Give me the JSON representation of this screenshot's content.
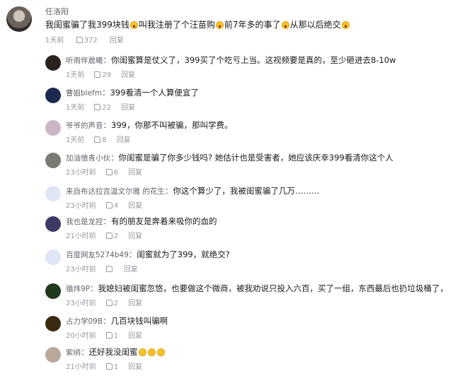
{
  "main": {
    "username": "任洛阳",
    "content_segments": [
      "我闺蜜骗了我399块钱",
      "叫我注册了个汪苗购",
      "前7年多的事了",
      "从那以后绝交"
    ],
    "time": "1天前",
    "likes": "372",
    "reply_label": "回复"
  },
  "replies": [
    {
      "user": "听雨伴晨曦",
      "text": "你闺蜜算是仗义了，399买了个吃亏上当。这视频要是真的，至少砸进去8-10w",
      "time": "1天前",
      "likes": "29",
      "reply": "回复",
      "avatar_color": "#2b2220"
    },
    {
      "user": "曹姐blefm",
      "text": "399看清一个人算便宜了",
      "time": "1天前",
      "likes": "22",
      "reply": "回复",
      "avatar_color": "#1d2a4e"
    },
    {
      "user": "爷爷的声音",
      "text": "399，你那不叫被骗，那叫学费。",
      "time": "1天前",
      "likes": "8",
      "reply": "回复",
      "avatar_color": "#c9b7c6"
    },
    {
      "user": "加油憤青小伙",
      "text": "你闺蜜是骗了你多少钱吗? 她估计也是受害者，她应该庆幸399看清你这个人",
      "time": "23小时前",
      "likes": "6",
      "reply": "回复",
      "avatar_color": "#7a7a72"
    },
    {
      "user": "来自布达拉宫温文尔雅 的花生",
      "text": "你这个算少了，我被闺蜜骗了几万………",
      "time": "23小时前",
      "likes": "4",
      "reply": "回复",
      "avatar_color": "#dfe6f5"
    },
    {
      "user": "我也是龙控",
      "text": "有的朋友是奔着来吸你的血的",
      "time": "21小时前",
      "likes": "2",
      "reply": "回复",
      "avatar_color": "#3d3a66"
    },
    {
      "user": "百度网友5274b49",
      "text": "闺蜜就为了399，就绝交?",
      "time": "23小时前",
      "likes": "",
      "reply": "回复",
      "avatar_color": "#dfe6f5"
    },
    {
      "user": "循炜9P",
      "text": "我媳妇被闺蜜忽悠，也要做这个微商，被我劝说只投入六百，买了一组，东西最后也扔垃圾桶了，",
      "time": "23小时前",
      "likes": "2",
      "reply": "回复",
      "avatar_color": "#1f3a1c"
    },
    {
      "user": "占力学09B",
      "text": "几百块钱叫骗啊",
      "time": "20小时前",
      "likes": "1",
      "reply": "回复",
      "avatar_color": "#3a2a10"
    },
    {
      "user": "紫绡",
      "text": "还好我没闺蜜",
      "time": "21小时前",
      "likes": "1",
      "reply": "回复",
      "avatar_color": "#b9a79a"
    }
  ],
  "icons": {
    "like": "thumbs-up-icon",
    "emoji": "laughing-emoji-icon",
    "emoji_smile": "smile-emoji-icon"
  }
}
